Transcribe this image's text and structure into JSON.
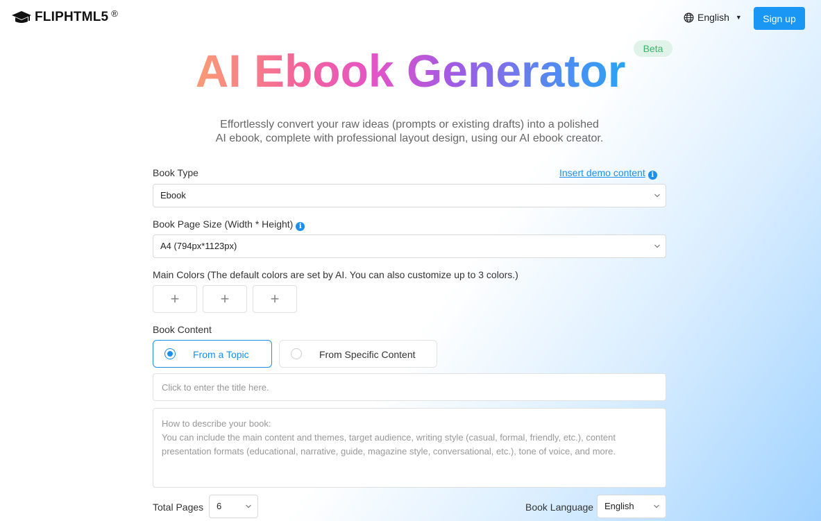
{
  "header": {
    "logo_text": "FLIPHTML5",
    "logo_mark": "®",
    "language_label": "English",
    "signup_label": "Sign up"
  },
  "hero": {
    "title": "AI Ebook Generator",
    "badge": "Beta",
    "subtitle_line1": "Effortlessly convert your raw ideas (prompts or existing drafts) into a polished",
    "subtitle_line2": "AI ebook, complete with professional layout design, using our AI ebook creator."
  },
  "form": {
    "book_type": {
      "label": "Book Type",
      "demo_link": "Insert demo content",
      "value": "Ebook"
    },
    "page_size": {
      "label": "Book Page Size (Width * Height)",
      "value": "A4 (794px*1123px)"
    },
    "colors": {
      "label": "Main Colors (The default colors are set by AI. You can also customize up to 3 colors.)",
      "add_symbol": "+"
    },
    "content": {
      "label": "Book Content",
      "options": [
        {
          "label": "From a Topic",
          "selected": true
        },
        {
          "label": "From Specific Content",
          "selected": false
        }
      ],
      "title_placeholder": "Click to enter the title here.",
      "description_placeholder": "How to describe your book:\nYou can include the main content and themes, target audience, writing style (casual, formal, friendly, etc.), content presentation formats (educational, narrative, guide, magazine style, conversational, etc.), tone of voice, and more."
    },
    "total_pages": {
      "label": "Total Pages",
      "value": "6"
    },
    "book_language": {
      "label": "Book Language",
      "value": "English"
    }
  },
  "colors": {
    "accent": "#1a97f5",
    "beta_bg": "#dff3e8",
    "beta_text": "#3ab46a"
  },
  "icons": [
    "graduation-cap-logo-icon",
    "globe-icon",
    "caret-down-icon",
    "info-icon",
    "chevron-down-icon",
    "plus-icon"
  ]
}
